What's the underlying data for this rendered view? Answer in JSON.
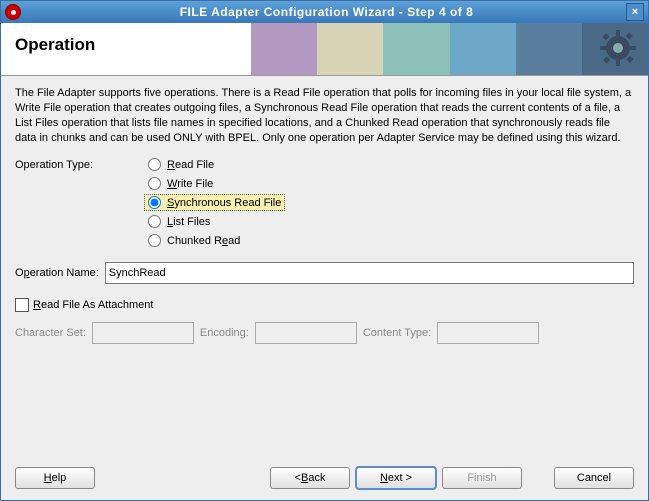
{
  "titlebar": {
    "title": "FILE Adapter Configuration Wizard - Step 4 of 8",
    "close_aria": "Close"
  },
  "banner": {
    "heading": "Operation"
  },
  "description": "The File Adapter supports five operations.  There is a Read File operation that polls for incoming files in your local file system, a Write File operation that creates outgoing files, a Synchronous Read File operation that reads the current contents of a file, a List Files operation that lists file names in specified locations, and a Chunked Read operation that synchronously reads file data in chunks and can be used ONLY with BPEL. Only one operation per Adapter Service may be defined using this wizard.",
  "labels": {
    "operation_type": "Operation Type:",
    "operation_name_pre": "O",
    "operation_name_u": "p",
    "operation_name_post": "eration Name:",
    "read_attach_pre": "",
    "read_attach_u": "R",
    "read_attach_post": "ead File As Attachment",
    "charset": "Character Set:",
    "encoding": "Encoding:",
    "content_type": "Content Type:"
  },
  "radios": {
    "read": {
      "u": "R",
      "rest": "ead File"
    },
    "write": {
      "u": "W",
      "rest": "rite File"
    },
    "sync": {
      "u": "S",
      "rest": "ynchronous Read File"
    },
    "list": {
      "u": "L",
      "rest": "ist Files"
    },
    "chunk": {
      "pre": "Chunked R",
      "u": "e",
      "post": "ad"
    }
  },
  "fields": {
    "operation_name": "SynchRead",
    "charset": "",
    "encoding": "",
    "content_type": ""
  },
  "buttons": {
    "help": "Help",
    "back": "< Back",
    "next": "Next >",
    "finish": "Finish",
    "cancel": "Cancel"
  },
  "buttons_u": {
    "help": "H",
    "back": "B",
    "next": "N",
    "finish": "F"
  }
}
